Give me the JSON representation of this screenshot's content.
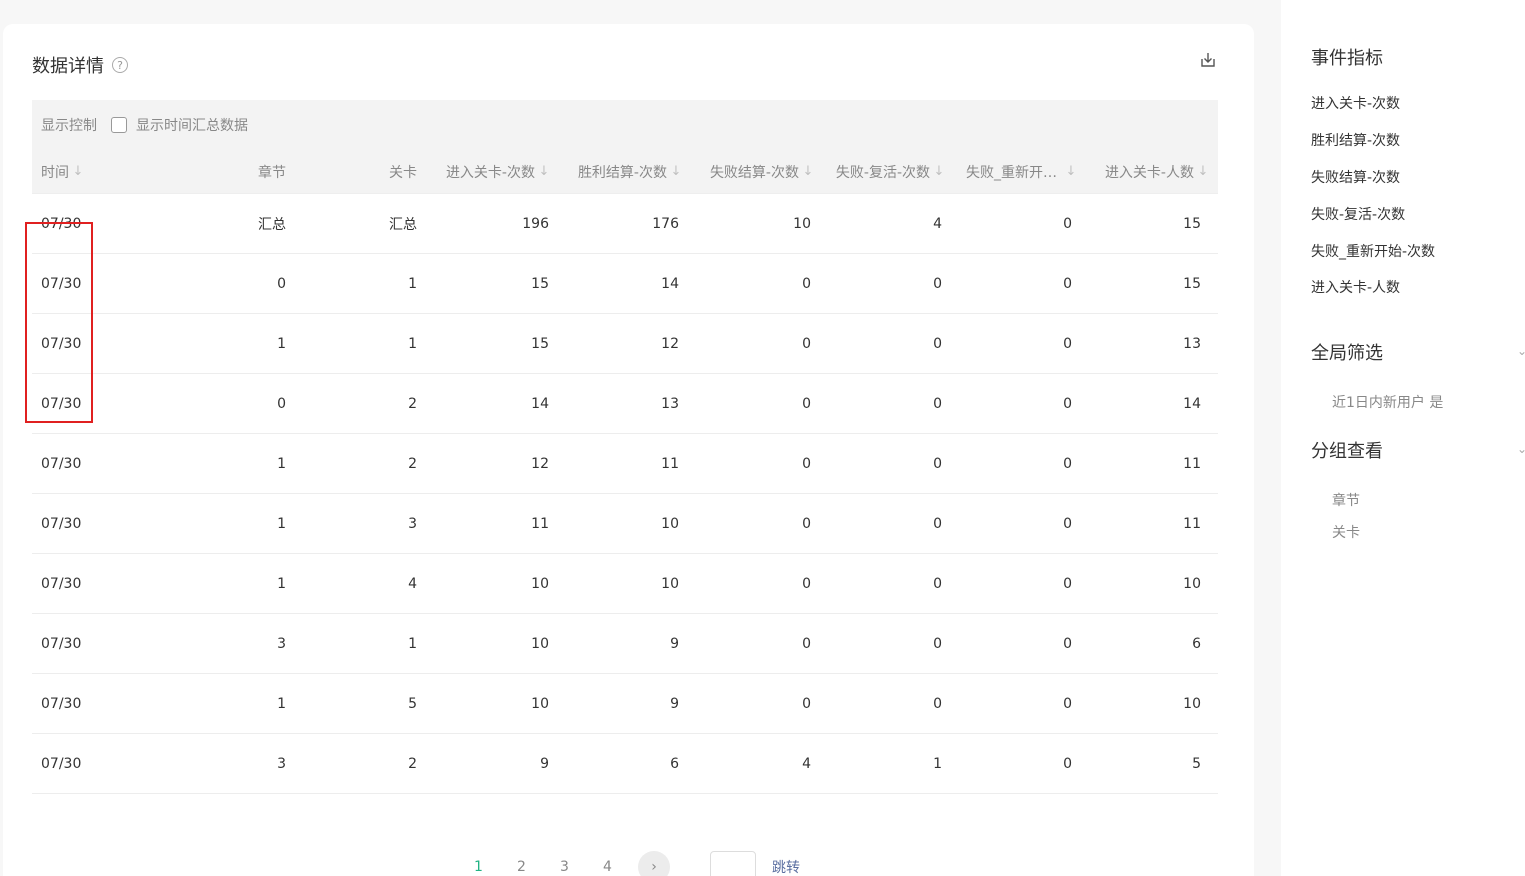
{
  "panel": {
    "title": "数据详情",
    "help_icon": "?",
    "display_control_label": "显示控制",
    "show_time_summary_label": "显示时间汇总数据"
  },
  "columns": [
    "时间",
    "章节",
    "关卡",
    "进入关卡-次数",
    "胜利结算-次数",
    "失败结算-次数",
    "失败-复活-次数",
    "失败_重新开始-次数",
    "进入关卡-人数"
  ],
  "rows": [
    [
      "07/30",
      "汇总",
      "汇总",
      "196",
      "176",
      "10",
      "4",
      "0",
      "15"
    ],
    [
      "07/30",
      "0",
      "1",
      "15",
      "14",
      "0",
      "0",
      "0",
      "15"
    ],
    [
      "07/30",
      "1",
      "1",
      "15",
      "12",
      "0",
      "0",
      "0",
      "13"
    ],
    [
      "07/30",
      "0",
      "2",
      "14",
      "13",
      "0",
      "0",
      "0",
      "14"
    ],
    [
      "07/30",
      "1",
      "2",
      "12",
      "11",
      "0",
      "0",
      "0",
      "11"
    ],
    [
      "07/30",
      "1",
      "3",
      "11",
      "10",
      "0",
      "0",
      "0",
      "11"
    ],
    [
      "07/30",
      "1",
      "4",
      "10",
      "10",
      "0",
      "0",
      "0",
      "10"
    ],
    [
      "07/30",
      "3",
      "1",
      "10",
      "9",
      "0",
      "0",
      "0",
      "6"
    ],
    [
      "07/30",
      "1",
      "5",
      "10",
      "9",
      "0",
      "0",
      "0",
      "10"
    ],
    [
      "07/30",
      "3",
      "2",
      "9",
      "6",
      "4",
      "1",
      "0",
      "5"
    ]
  ],
  "pagination": {
    "pages": [
      "1",
      "2",
      "3",
      "4"
    ],
    "current": "1",
    "next_icon": "›",
    "jump_label": "跳转"
  },
  "sidebar": {
    "metrics_title": "事件指标",
    "metrics": [
      "进入关卡-次数",
      "胜利结算-次数",
      "失败结算-次数",
      "失败-复活-次数",
      "失败_重新开始-次数",
      "进入关卡-人数"
    ],
    "global_filter_title": "全局筛选",
    "global_filter_value": "近1日内新用户 是",
    "group_title": "分组查看",
    "groups": [
      "章节",
      "关卡"
    ]
  },
  "colors": {
    "accent": "#22b384",
    "highlight": "#e02020",
    "link": "#5a6ea0"
  }
}
